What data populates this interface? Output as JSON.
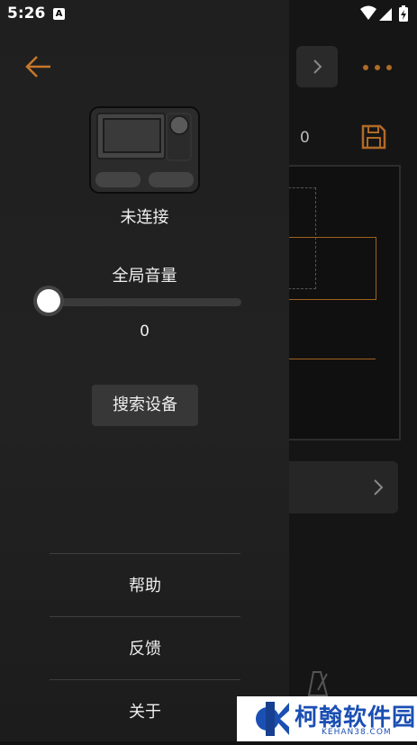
{
  "status_bar": {
    "time": "5:26",
    "notif_letter": "A",
    "icons": [
      "wifi-icon",
      "signal-icon",
      "battery-charging-icon"
    ]
  },
  "background_app": {
    "value": "0",
    "icons": [
      "chevron-right-icon",
      "more-icon",
      "save-icon",
      "chevron-right-icon",
      "metronome-icon"
    ],
    "accent_color": "#c8782a"
  },
  "drawer": {
    "back_icon": "arrow-left-icon",
    "device_icon": "device-icon",
    "connection_status": "未连接",
    "volume_label": "全局音量",
    "volume_value": "0",
    "volume_level": 0,
    "search_button": "搜索设备",
    "menu": [
      {
        "label": "帮助"
      },
      {
        "label": "反馈"
      },
      {
        "label": "关于"
      }
    ]
  },
  "watermark": {
    "text": "柯翰软件园",
    "sub": "KEHAN38.COM"
  }
}
